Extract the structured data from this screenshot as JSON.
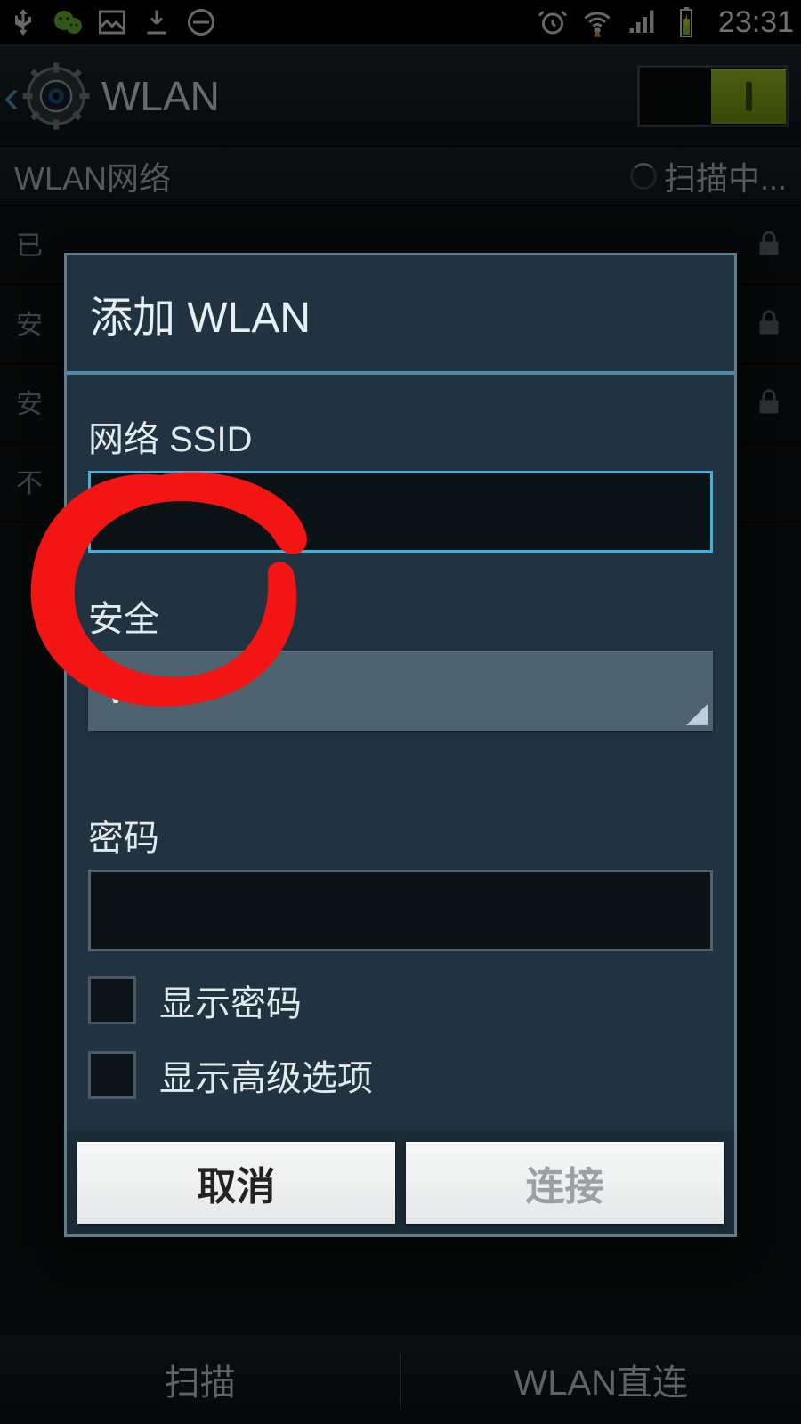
{
  "statusbar": {
    "time": "23:31"
  },
  "actionbar": {
    "title": "WLAN"
  },
  "section": {
    "label": "WLAN网络",
    "scanning": "扫描中..."
  },
  "bg": {
    "r1_name": " ",
    "r1_sub": "已",
    "r2_name": " ",
    "r2_sub": "安",
    "r3_name": " ",
    "r3_sub": "安",
    "r4_name": " ",
    "r4_sub": "不"
  },
  "bottombar": {
    "scan": "扫描",
    "direct": "WLAN直连"
  },
  "dialog": {
    "title": "添加 WLAN",
    "ssid_label": "网络 SSID",
    "ssid_value": "",
    "security_label": "安全",
    "security_value": "WEP",
    "password_label": "密码",
    "password_value": "",
    "show_password": "显示密码",
    "show_advanced": "显示高级选项",
    "cancel": "取消",
    "connect": "连接"
  }
}
